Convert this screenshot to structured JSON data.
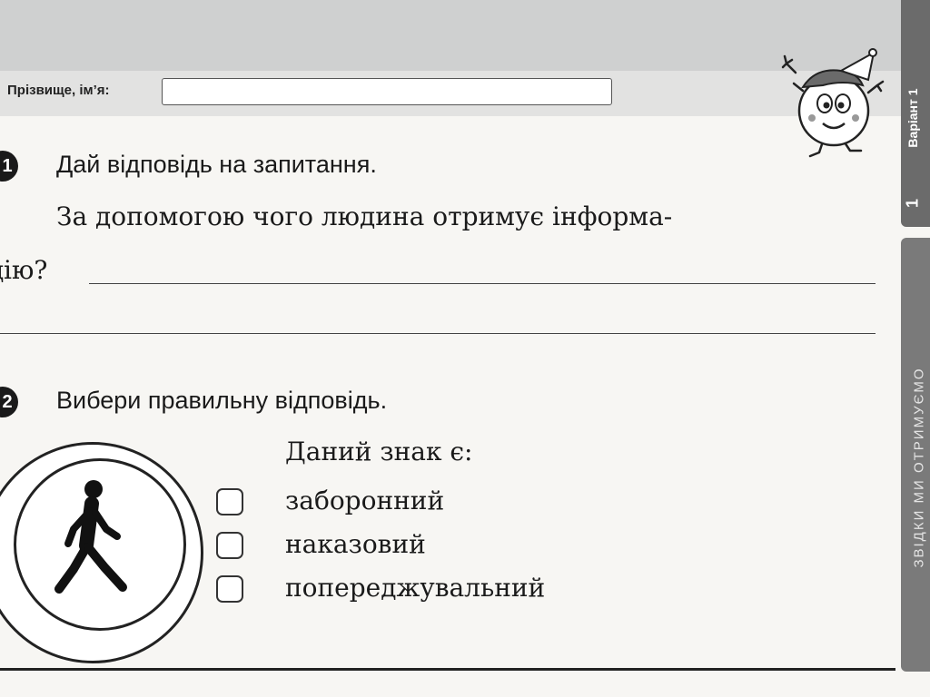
{
  "header": {
    "name_label": "Прізвище, ім’я:"
  },
  "sidebar": {
    "variant_label": "Варіант 1",
    "variant_number": "1",
    "section_title": "ЗВІДКИ МИ ОТРИМУЄМО"
  },
  "task1": {
    "number": "1",
    "instruction": "Дай відповідь на запитання.",
    "question_line1": "За допомогою чого людина отримує інформа-",
    "question_line2": "цію?"
  },
  "task2": {
    "number": "2",
    "instruction": "Вибери правильну відповідь.",
    "prompt": "Даний знак є:",
    "options": [
      "заборонний",
      "наказовий",
      "попереджувальний"
    ]
  }
}
